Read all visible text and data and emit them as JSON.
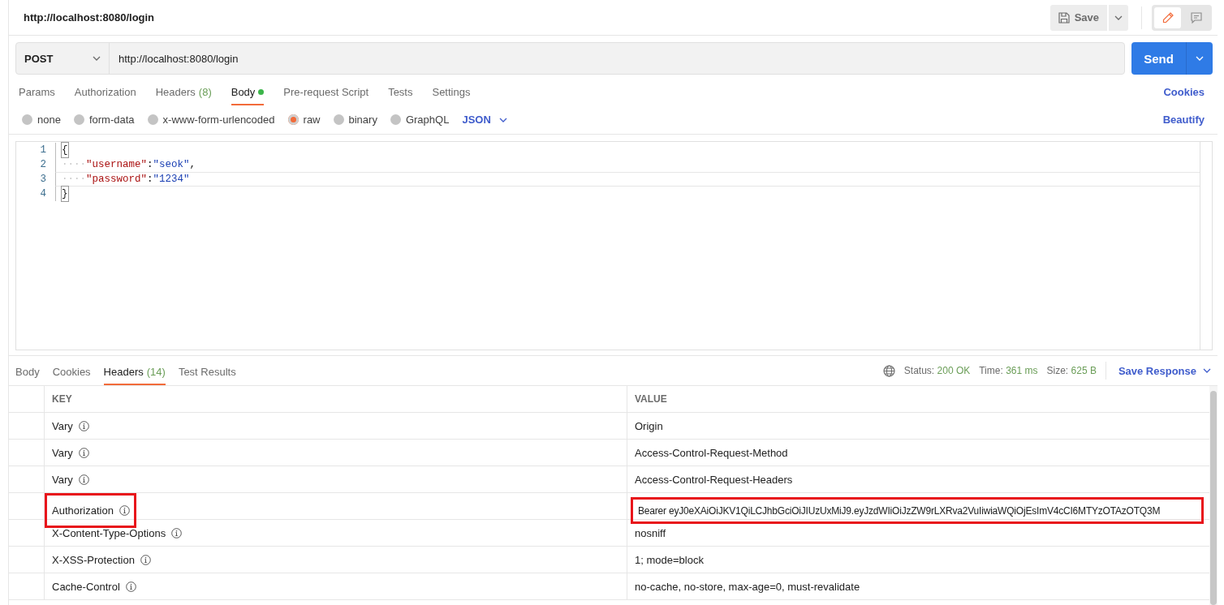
{
  "header": {
    "title": "http://localhost:8080/login",
    "save_label": "Save",
    "mode_buttons": [
      {
        "kind": "edit",
        "selected": true
      },
      {
        "kind": "comment",
        "selected": false
      }
    ]
  },
  "request": {
    "method": "POST",
    "url": "http://localhost:8080/login",
    "send_label": "Send"
  },
  "request_tabs": [
    {
      "label": "Params",
      "selected": false
    },
    {
      "label": "Authorization",
      "selected": false
    },
    {
      "label": "Headers",
      "count": "(8)",
      "selected": false
    },
    {
      "label": "Body",
      "has_content": true,
      "selected": true
    },
    {
      "label": "Pre-request Script",
      "selected": false
    },
    {
      "label": "Tests",
      "selected": false
    },
    {
      "label": "Settings",
      "selected": false
    }
  ],
  "cookies_link": "Cookies",
  "body_types": [
    {
      "label": "none",
      "selected": false
    },
    {
      "label": "form-data",
      "selected": false
    },
    {
      "label": "x-www-form-urlencoded",
      "selected": false
    },
    {
      "label": "raw",
      "selected": true
    },
    {
      "label": "binary",
      "selected": false
    },
    {
      "label": "GraphQL",
      "selected": false
    }
  ],
  "format": "JSON",
  "beautify_link": "Beautify",
  "editor": {
    "lines": [
      {
        "number": "1",
        "active": false,
        "tokens": [
          {
            "kind": "bracket",
            "text": "{"
          }
        ]
      },
      {
        "number": "2",
        "active": false,
        "tokens": [
          {
            "kind": "indent",
            "text": "····"
          },
          {
            "kind": "key",
            "text": "\"username\""
          },
          {
            "kind": "punct",
            "text": ":"
          },
          {
            "kind": "string",
            "text": "\"seok\""
          },
          {
            "kind": "punct",
            "text": ","
          }
        ]
      },
      {
        "number": "3",
        "active": true,
        "tokens": [
          {
            "kind": "indent",
            "text": "····"
          },
          {
            "kind": "key",
            "text": "\"password\""
          },
          {
            "kind": "punct",
            "text": ":"
          },
          {
            "kind": "string",
            "text": "\"1234\""
          }
        ]
      },
      {
        "number": "4",
        "active": false,
        "tokens": [
          {
            "kind": "bracket",
            "text": "}"
          }
        ]
      }
    ]
  },
  "response_tabs": [
    {
      "label": "Body",
      "selected": false
    },
    {
      "label": "Cookies",
      "selected": false
    },
    {
      "label": "Headers",
      "count": "(14)",
      "selected": true
    },
    {
      "label": "Test Results",
      "selected": false
    }
  ],
  "response_meta": [
    {
      "label": "Status:",
      "value": "200 OK"
    },
    {
      "label": "Time:",
      "value": "361 ms"
    },
    {
      "label": "Size:",
      "value": "625 B"
    }
  ],
  "save_response": "Save Response",
  "headers_table": {
    "columns": [
      "KEY",
      "VALUE"
    ],
    "rows": [
      {
        "key": "Vary",
        "value": "Origin",
        "highlighted": false
      },
      {
        "key": "Vary",
        "value": "Access-Control-Request-Method",
        "highlighted": false
      },
      {
        "key": "Vary",
        "value": "Access-Control-Request-Headers",
        "highlighted": false
      },
      {
        "key": "Authorization",
        "value": "Bearer eyJ0eXAiOiJKV1QiLCJhbGciOiJIUzUxMiJ9.eyJzdWIiOiJzZW9rLXRva2VuIiwiaWQiOjEsImV4cCI6MTYzOTAzOTQ3M",
        "highlighted": true
      },
      {
        "key": "X-Content-Type-Options",
        "value": "nosniff",
        "highlighted": false
      },
      {
        "key": "X-XSS-Protection",
        "value": "1; mode=block",
        "highlighted": false
      },
      {
        "key": "Cache-Control",
        "value": "no-cache, no-store, max-age=0, must-revalidate",
        "highlighted": false
      }
    ]
  }
}
